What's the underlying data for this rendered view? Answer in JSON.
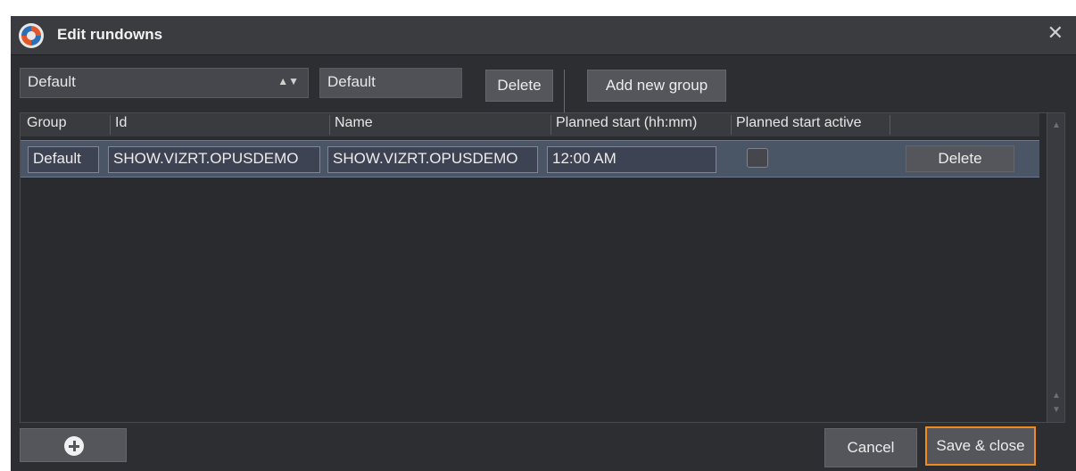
{
  "window": {
    "title": "Edit rundowns",
    "close_glyph": "✕"
  },
  "toolbar": {
    "group_select_value": "Default",
    "group_name_value": "Default",
    "delete_label": "Delete",
    "add_group_label": "Add new group"
  },
  "table": {
    "columns": [
      "Group",
      "Id",
      "Name",
      "Planned start (hh:mm)",
      "Planned start active"
    ],
    "rows": [
      {
        "group": "Default",
        "id": "SHOW.VIZRT.OPUSDEMO",
        "name": "SHOW.VIZRT.OPUSDEMO",
        "planned_start": "12:00 AM",
        "planned_start_active": false,
        "delete_label": "Delete"
      }
    ]
  },
  "footer": {
    "add_icon": "plus-circle-icon",
    "cancel_label": "Cancel",
    "save_label": "Save & close"
  },
  "colors": {
    "accent": "#f08a1c",
    "selected_row": "#4a5566",
    "background": "#2d2e32"
  }
}
